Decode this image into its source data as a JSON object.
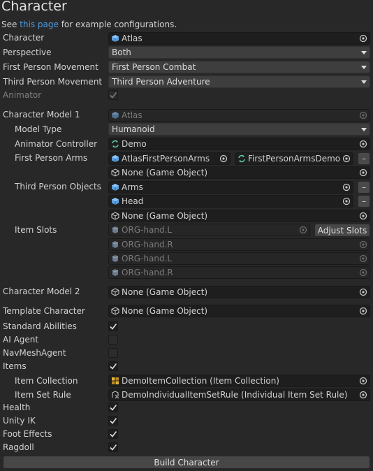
{
  "header": {
    "title": "Character",
    "see_prefix": "See ",
    "see_link": "this page",
    "see_suffix": " for example configurations."
  },
  "fields": {
    "character": {
      "label": "Character",
      "value": "Atlas"
    },
    "perspective": {
      "label": "Perspective",
      "value": "Both"
    },
    "fp_movement": {
      "label": "First Person Movement",
      "value": "First Person Combat"
    },
    "tp_movement": {
      "label": "Third Person Movement",
      "value": "Third Person Adventure"
    },
    "animator": {
      "label": "Animator"
    }
  },
  "model1": {
    "label": "Character Model 1",
    "value": "Atlas",
    "model_type": {
      "label": "Model Type",
      "value": "Humanoid"
    },
    "animator_controller": {
      "label": "Animator Controller",
      "value": "Demo"
    },
    "fp_arms": {
      "label": "First Person Arms",
      "arm": "AtlasFirstPersonArms",
      "controller": "FirstPersonArmsDemo",
      "empty": "None (Game Object)"
    },
    "tp_objects": {
      "label": "Third Person Objects",
      "items": [
        "Arms",
        "Head"
      ],
      "empty": "None (Game Object)"
    },
    "item_slots": {
      "label": "Item Slots",
      "slots": [
        "ORG-hand.L",
        "ORG-hand.R",
        "ORG-hand.L",
        "ORG-hand.R"
      ],
      "adjust_button": "Adjust Slots"
    }
  },
  "model2": {
    "label": "Character Model 2",
    "value": "None (Game Object)"
  },
  "template": {
    "label": "Template Character",
    "value": "None (Game Object)"
  },
  "toggles": {
    "standard_abilities": {
      "label": "Standard Abilities",
      "checked": true
    },
    "ai_agent": {
      "label": "AI Agent",
      "checked": false
    },
    "navmesh_agent": {
      "label": "NavMeshAgent",
      "checked": false
    },
    "items": {
      "label": "Items",
      "checked": true
    }
  },
  "items_section": {
    "collection": {
      "label": "Item Collection",
      "value": "DemoItemCollection (Item Collection)"
    },
    "set_rule": {
      "label": "Item Set Rule",
      "value": "DemoIndividualItemSetRule (Individual Item Set Rule)"
    }
  },
  "toggles2": {
    "health": {
      "label": "Health",
      "checked": true
    },
    "unity_ik": {
      "label": "Unity IK",
      "checked": true
    },
    "foot_effects": {
      "label": "Foot Effects",
      "checked": true
    },
    "ragdoll": {
      "label": "Ragdoll",
      "checked": true
    }
  },
  "footer": {
    "build_button": "Build Character"
  },
  "colors": {
    "background": "#282828",
    "link": "#4c9ee6",
    "field": "#1e1e1e",
    "button": "#474747"
  }
}
